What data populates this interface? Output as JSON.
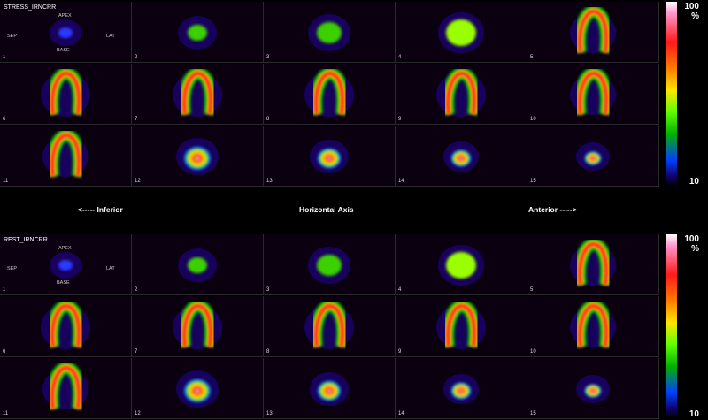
{
  "stress": {
    "title": "STRESS_IRNCRR",
    "orientation": {
      "top": "APEX",
      "left": "SEP",
      "right": "LAT",
      "bottom": "BASE"
    },
    "slices": [
      "1",
      "2",
      "3",
      "4",
      "5",
      "6",
      "7",
      "8",
      "9",
      "10",
      "11",
      "12",
      "13",
      "14",
      "15"
    ]
  },
  "rest": {
    "title": "REST_IRNCRR",
    "orientation": {
      "top": "APEX",
      "left": "SEP",
      "right": "LAT",
      "bottom": "BASE"
    },
    "slices": [
      "1",
      "2",
      "3",
      "4",
      "5",
      "6",
      "7",
      "8",
      "9",
      "10",
      "11",
      "12",
      "13",
      "14",
      "15"
    ]
  },
  "axis": {
    "left": "<----- Inferior",
    "center": "Horizontal Axis",
    "right": "Anterior ----->"
  },
  "scale": {
    "top_label": "100",
    "unit": "%",
    "bottom_label": "10"
  },
  "colors": {
    "background": "#000000",
    "cell_bg": "#0b0010"
  }
}
